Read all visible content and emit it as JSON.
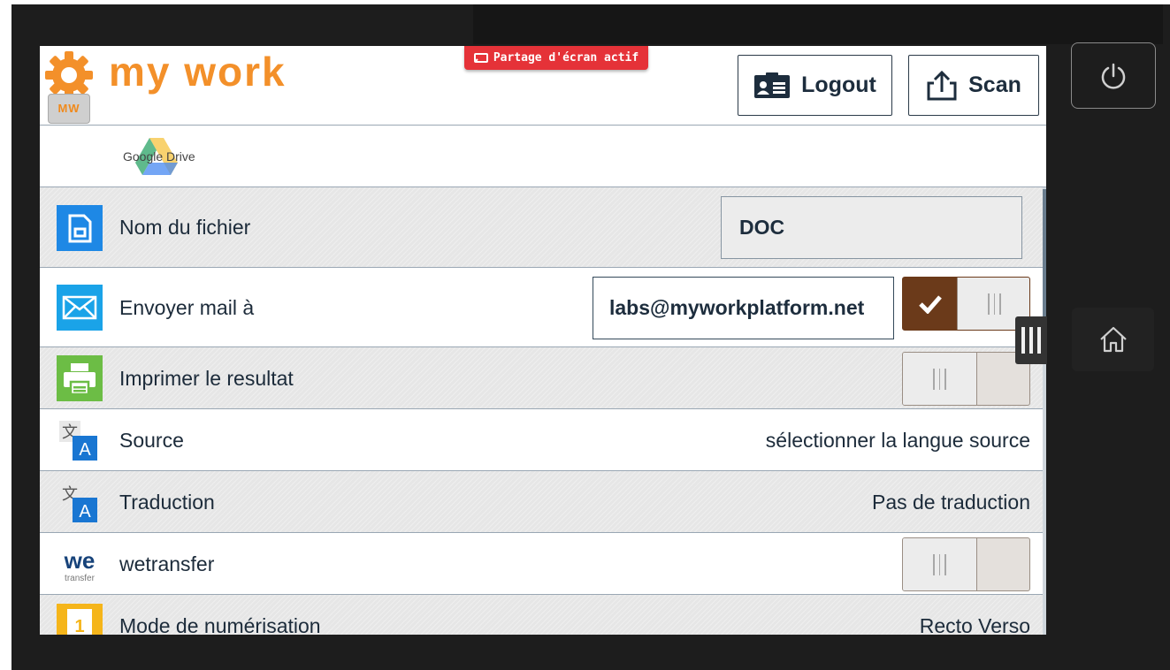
{
  "app": {
    "logo_text": "my work",
    "logo_badge": "MW",
    "screen_share_badge": "Partage d'écran actif"
  },
  "header": {
    "logout_label": "Logout",
    "scan_label": "Scan"
  },
  "service": {
    "name": "Google Drive"
  },
  "rows": [
    {
      "label": "Nom du fichier",
      "value": "DOC",
      "icon": "file-icon",
      "icon_color": "#1e88e5"
    },
    {
      "label": "Envoyer mail à",
      "value": "labs@myworkplatform.net",
      "toggle": "on",
      "icon": "mail-icon",
      "icon_color": "#1aa3e8"
    },
    {
      "label": "Imprimer le resultat",
      "toggle": "off",
      "icon": "printer-icon",
      "icon_color": "#6cbd45"
    },
    {
      "label": "Source",
      "value": "sélectionner la langue source",
      "icon": "translate-icon"
    },
    {
      "label": "Traduction",
      "value": "Pas de traduction",
      "icon": "translate-icon"
    },
    {
      "label": "wetransfer",
      "toggle": "off",
      "icon": "wetransfer-icon",
      "icon_sub": "transfer"
    },
    {
      "label": "Mode de numérisation",
      "value": "Recto Verso",
      "icon": "scan-mode-icon",
      "icon_number": "1",
      "icon_color": "#f5b51a"
    }
  ],
  "colors": {
    "brand_orange": "#f3902a",
    "toggle_on": "#6b3a1a",
    "share_red": "#e53238",
    "text_dark": "#1c2b3a"
  }
}
